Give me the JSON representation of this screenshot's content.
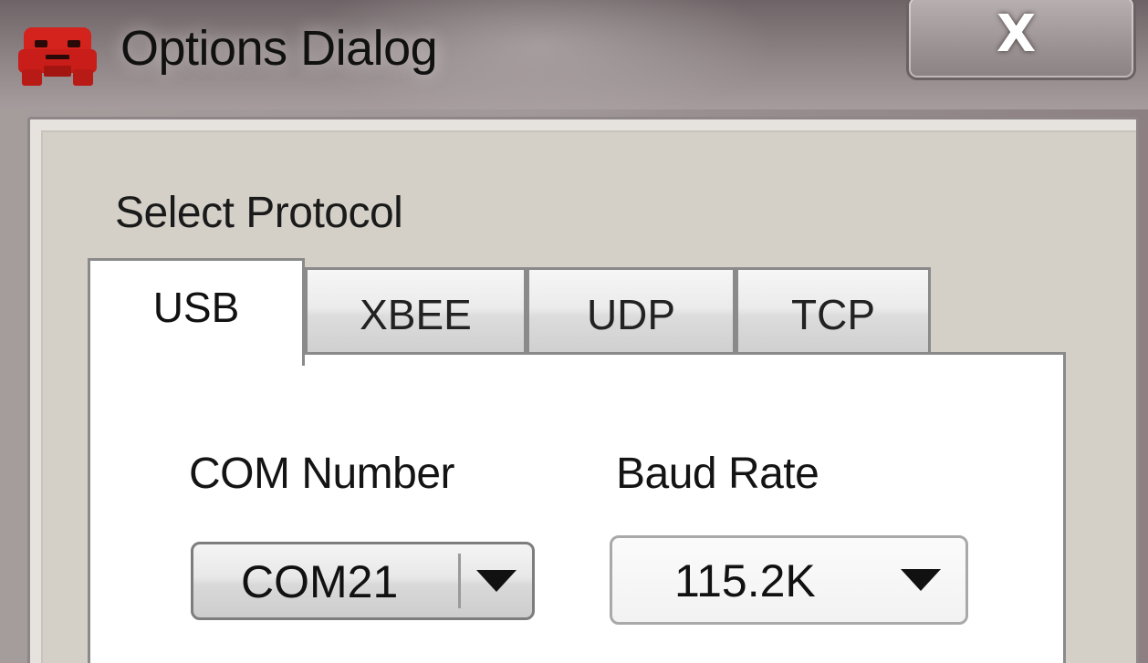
{
  "window": {
    "title": "Options Dialog",
    "close_glyph": "X",
    "icon": "red-robot-icon"
  },
  "protocol": {
    "group_label": "Select Protocol",
    "tabs": [
      {
        "label": "USB",
        "selected": true
      },
      {
        "label": "XBEE",
        "selected": false
      },
      {
        "label": "UDP",
        "selected": false
      },
      {
        "label": "TCP",
        "selected": false
      }
    ]
  },
  "usb": {
    "com_label": "COM Number",
    "com_value": "COM21",
    "baud_label": "Baud Rate",
    "baud_value": "115.2K"
  },
  "colors": {
    "icon_red": "#d4221c",
    "dialog_bg": "#d4d0c8",
    "tab_panel_bg": "#ffffff"
  }
}
